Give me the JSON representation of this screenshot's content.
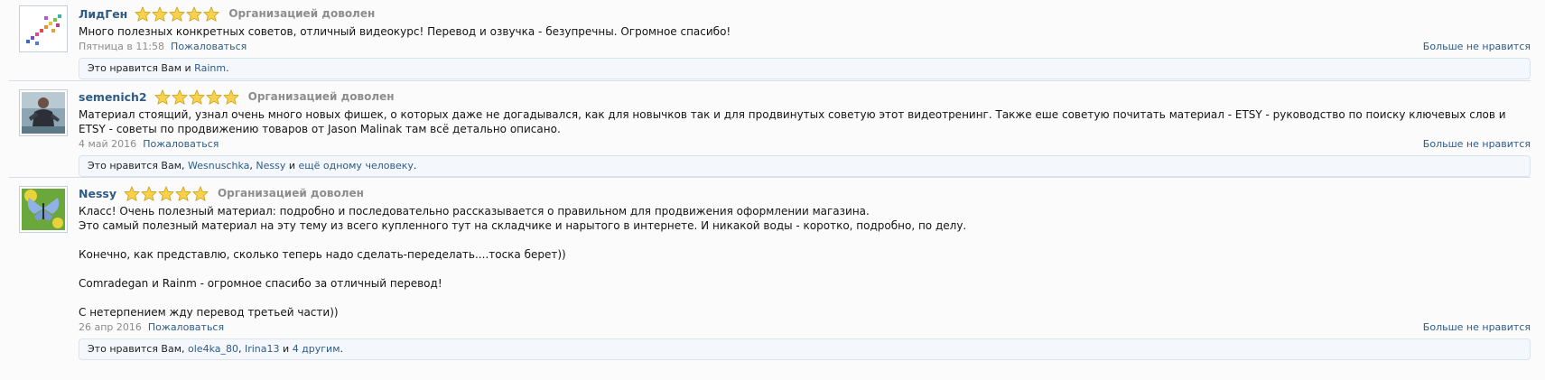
{
  "colors": {
    "link": "#2f5b85",
    "star_fill": "#f7d24a",
    "star_outline": "#c99a10"
  },
  "icons": {
    "star": "star-icon"
  },
  "reviews": [
    {
      "username": "ЛидГен",
      "stars": 5,
      "rating_text": "Организацией доволен",
      "text": [
        "Много полезных конкретных советов, отличный видеокурс! Перевод и озвучка - безупречны. Огромное спасибо!"
      ],
      "date": "Пятница в 11:58",
      "report": "Пожаловаться",
      "unlike": "Больше не нравится",
      "likes": {
        "prefix": "Это нравится Вам и ",
        "users": [
          "Rainm"
        ],
        "separators": [
          "."
        ]
      }
    },
    {
      "username": "semenich2",
      "stars": 5,
      "rating_text": "Организацией доволен",
      "text": [
        "Материал стоящий, узнал очень много новых фишек, о которых даже не догадывался, как для новычков так и для продвинутых советую этот видеотренинг. Также еше советую почитать материал - ETSY - руководство по поиску ключевых слов и ETSY - советы по продвижению товаров от Jason Malinak там всё детально описано."
      ],
      "date": "4 май 2016",
      "report": "Пожаловаться",
      "unlike": "Больше не нравится",
      "likes": {
        "prefix": "Это нравится Вам, ",
        "users": [
          "Wesnuschka",
          "Nessy",
          "ещё одному человеку"
        ],
        "separators": [
          ", ",
          " и ",
          "."
        ]
      }
    },
    {
      "username": "Nessy",
      "stars": 5,
      "rating_text": "Организацией доволен",
      "text": [
        "Класс! Очень полезный материал: подробно и последовательно рассказывается о правильном для продвижения оформлении магазина.",
        "Это самый полезный материал на эту тему из всего купленного тут на складчике и нарытого в интернете. И никакой воды - коротко, подробно, по делу.",
        "Конечно, как представлю, сколько теперь надо сделать-переделать....тоска берет))",
        "Comradegan и Rainm - огромное спасибо за отличный перевод!",
        "С нетерпением жду перевод третьей части))"
      ],
      "date": "26 апр 2016",
      "report": "Пожаловаться",
      "unlike": "Больше не нравится",
      "likes": {
        "prefix": "Это нравится Вам, ",
        "users": [
          "ole4ka_80",
          "Irina13",
          "4 другим"
        ],
        "separators": [
          ", ",
          " и ",
          "."
        ]
      }
    }
  ]
}
